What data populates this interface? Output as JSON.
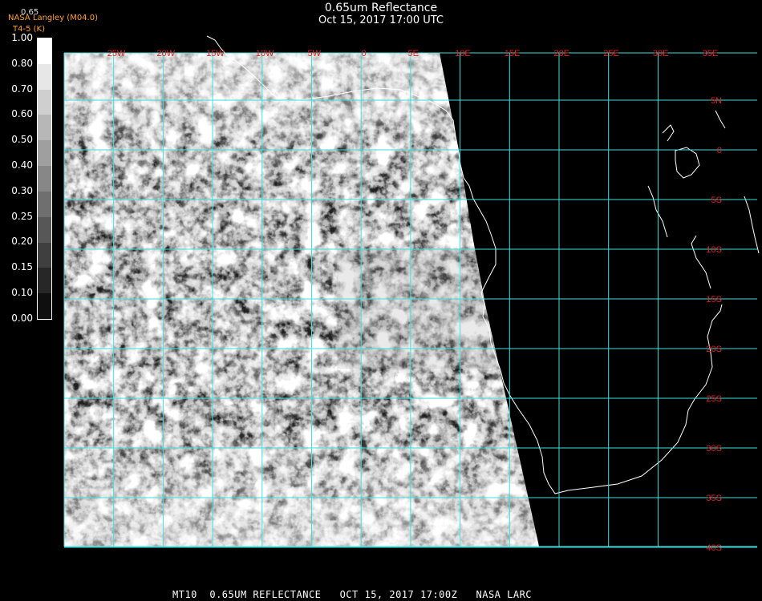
{
  "header": {
    "title": "0.65um Reflectance",
    "datetime": "Oct 15, 2017 17:00 UTC",
    "credit": "NASA Langley (M04.0)",
    "credit2": "T4-5 (K)",
    "colorbar_top_value": "0.65"
  },
  "colorbar": {
    "labels": [
      "1.00",
      "0.80",
      "0.70",
      "0.60",
      "0.50",
      "0.40",
      "0.30",
      "0.25",
      "0.20",
      "0.15",
      "0.10",
      "0.00"
    ]
  },
  "map": {
    "longitude_labels": [
      "25W",
      "20W",
      "15W",
      "10W",
      "5W",
      "0",
      "5E",
      "10E",
      "15E",
      "20E",
      "25E",
      "30E",
      "35E"
    ],
    "latitude_labels": [
      "5N",
      "0",
      "5S",
      "10S",
      "15S",
      "20S",
      "25S",
      "30S",
      "35S",
      "40S"
    ],
    "grid_color": "#40e0e0",
    "label_color": "#e02020"
  },
  "footer": {
    "text": "MT10  0.65UM REFLECTANCE   OCT 15, 2017 17:00Z   NASA LARC"
  }
}
